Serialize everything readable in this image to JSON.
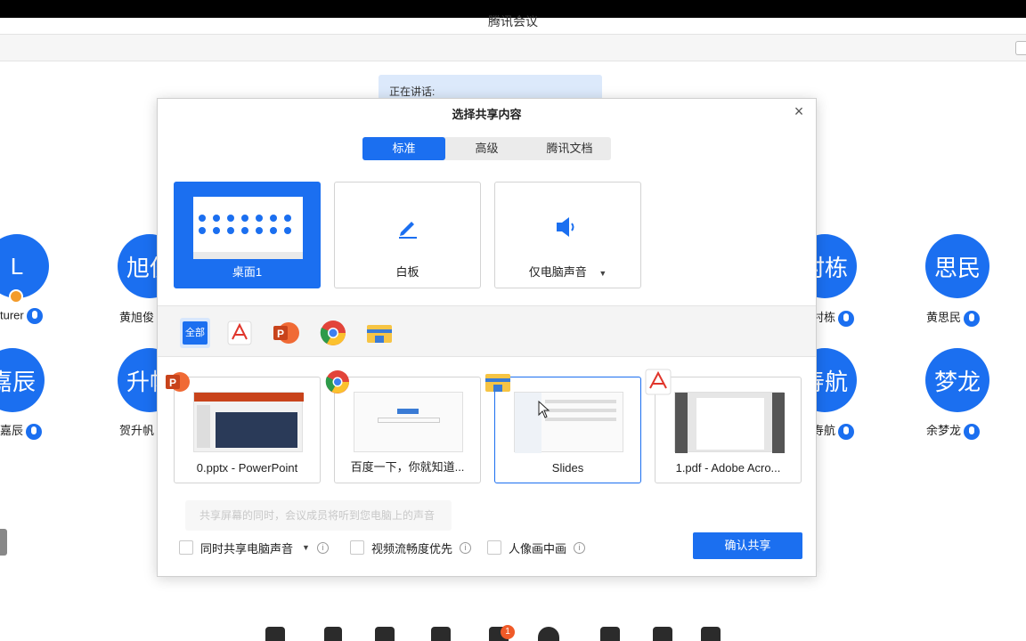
{
  "window": {
    "title": "腾讯会议"
  },
  "speaking": {
    "label": "正在讲话:"
  },
  "participants": [
    {
      "initials": "L",
      "name": "turer"
    },
    {
      "initials": "旭侈",
      "name": "黄旭俊"
    },
    {
      "initials": "村栋",
      "name": "村栋"
    },
    {
      "initials": "思民",
      "name": "黄思民"
    },
    {
      "initials": "嘉辰",
      "name": "嘉辰"
    },
    {
      "initials": "升帆",
      "name": "贺升帆"
    },
    {
      "initials": "寿航",
      "name": "寿航"
    },
    {
      "initials": "梦龙",
      "name": "余梦龙"
    }
  ],
  "dialog": {
    "title": "选择共享内容",
    "close": "×",
    "tabs": [
      "标准",
      "高级",
      "腾讯文档"
    ],
    "top_cards": [
      {
        "label": "桌面1"
      },
      {
        "label": "白板",
        "icon": "pen-icon"
      },
      {
        "label": "仅电脑声音",
        "caret": "▼",
        "icon": "speaker-icon"
      }
    ],
    "filters": {
      "all": "全部"
    },
    "windows": [
      {
        "label": "0.pptx - PowerPoint",
        "app": "powerpoint"
      },
      {
        "label": "百度一下，你就知道...",
        "app": "chrome"
      },
      {
        "label": "Slides",
        "app": "file-explorer"
      },
      {
        "label": "1.pdf - Adobe Acro...",
        "app": "acrobat"
      }
    ],
    "notice": "共享屏幕的同时，会议成员将听到您电脑上的声音",
    "options": [
      {
        "label": "同时共享电脑声音",
        "caret": "▼"
      },
      {
        "label": "视频流畅度优先"
      },
      {
        "label": "人像画中画"
      }
    ],
    "info_glyph": "i",
    "confirm": "确认共享"
  },
  "notification_count": "1",
  "colors": {
    "accent": "#1b6ff0",
    "host": "#f39b2b",
    "badge": "#f05a28"
  }
}
